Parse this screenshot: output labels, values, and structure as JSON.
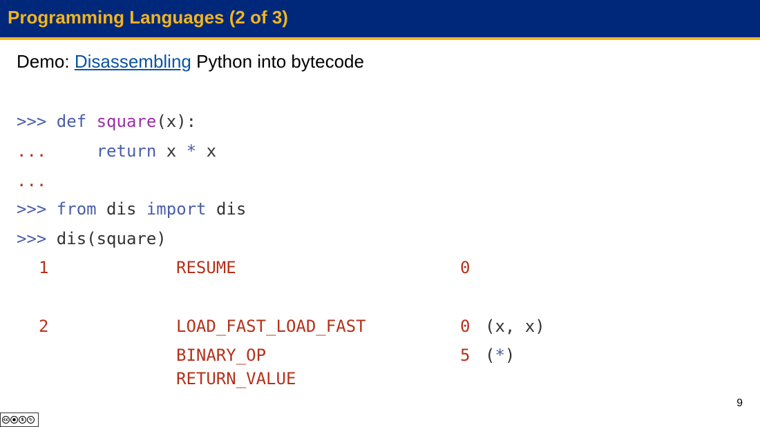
{
  "header": {
    "title": "Programming Languages (2 of 3)"
  },
  "subtitle": {
    "prefix": "Demo: ",
    "link_text": "Disassembling",
    "suffix": " Python into bytecode"
  },
  "code": {
    "line1": {
      "prompt": ">>> ",
      "kw": "def",
      "sp": " ",
      "fn": "square",
      "rest": "(x):"
    },
    "line2": {
      "prompt": "...",
      "indent": "     ",
      "kw": "return",
      "a": " x ",
      "op": "*",
      "b": " x"
    },
    "line3": {
      "prompt": "..."
    },
    "line4": {
      "prompt": ">>> ",
      "kw1": "from",
      "mid": " dis ",
      "kw2": "import",
      "end": " dis"
    },
    "line5": {
      "prompt": ">>> ",
      "rest": "dis(square)"
    },
    "dis": {
      "row1": {
        "lineno": "1",
        "opname": "RESUME",
        "arg": "0",
        "argrepr": ""
      },
      "row2": {
        "lineno": "2",
        "opname": "LOAD_FAST_LOAD_FAST",
        "arg": "0",
        "argrepr": "(x, x)"
      },
      "row3": {
        "lineno": "",
        "opname": "BINARY_OP",
        "arg": "5",
        "argrepr_open": "(",
        "argrepr_op": "*",
        "argrepr_close": ")"
      },
      "row4": {
        "lineno": "",
        "opname": "RETURN_VALUE",
        "arg": "",
        "argrepr": ""
      }
    }
  },
  "page_number": "9",
  "license_badge": {
    "icons": [
      "cc-icon",
      "by-icon",
      "nc-icon",
      "sa-icon"
    ],
    "labels": [
      "BY",
      "NC",
      "SA"
    ]
  }
}
